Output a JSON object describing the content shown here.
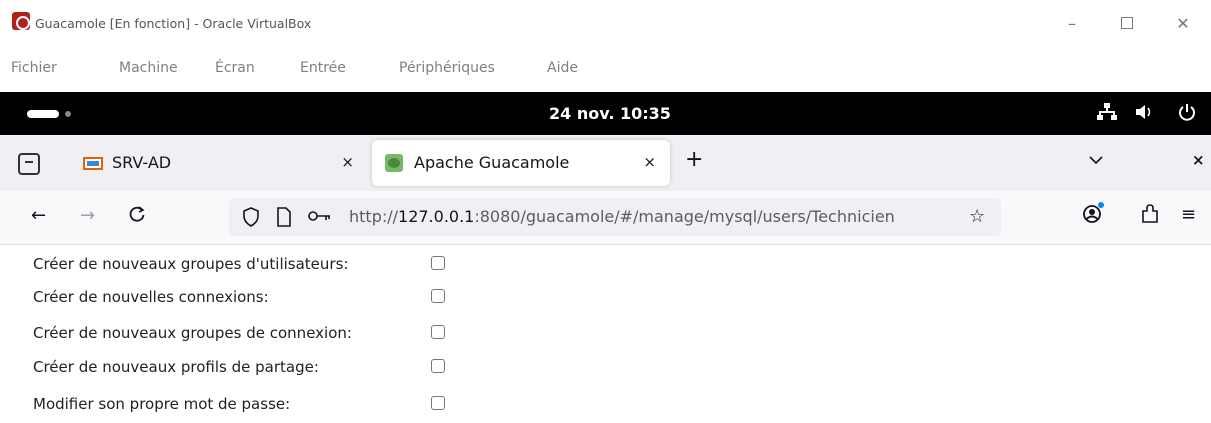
{
  "window": {
    "title": "Guacamole [En fonction] - Oracle VirtualBox",
    "minimize": "–",
    "close": "✕"
  },
  "menu": {
    "items": [
      "Fichier",
      "Machine",
      "Écran",
      "Entrée",
      "Périphériques",
      "Aide"
    ]
  },
  "gnome": {
    "clock": "24 nov. 10:35",
    "network_icon": "network-icon",
    "volume_icon": "volume-icon",
    "power_icon": "power-icon"
  },
  "tabs": [
    {
      "label": "SRV-AD",
      "close": "×",
      "icon": "monitor-icon"
    },
    {
      "label": "Apache Guacamole",
      "close": "×",
      "icon": "guacamole-icon"
    }
  ],
  "tabbar": {
    "new_tab": "+",
    "list_all": "⌄",
    "close_window": "×"
  },
  "navbar": {
    "back": "←",
    "forward": "→",
    "reload": "C",
    "url_prefix": "http://",
    "url_host": "127.0.0.1",
    "url_rest": ":8080/guacamole/#/manage/mysql/users/Technicien",
    "bookmark": "☆",
    "menu": "≡"
  },
  "permissions": [
    {
      "label": "Créer de nouveaux groupes d'utilisateurs:",
      "checked": false
    },
    {
      "label": "Créer de nouvelles connexions:",
      "checked": false
    },
    {
      "label": "Créer de nouveaux groupes de connexion:",
      "checked": false
    },
    {
      "label": "Créer de nouveaux profils de partage:",
      "checked": false
    },
    {
      "label": "Modifier son propre mot de passe:",
      "checked": false
    }
  ]
}
